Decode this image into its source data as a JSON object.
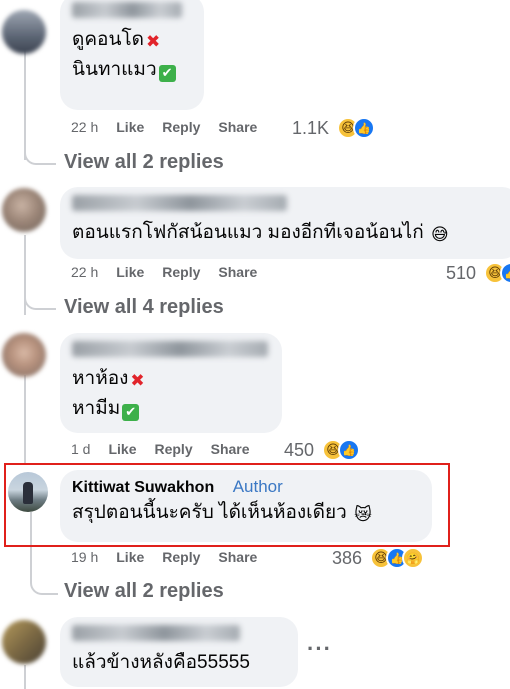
{
  "comments": [
    {
      "lines": [
        "ดูคอนโด",
        "นินทาแมว"
      ],
      "line_marks": [
        "x",
        "check"
      ],
      "meta": {
        "time": "22 h",
        "like": "Like",
        "reply": "Reply",
        "share": "Share"
      },
      "reaction_count": "1.1K",
      "view_replies": "View all 2 replies"
    },
    {
      "lines": [
        "ตอนแรกโฟกัสน้อนแมว มองอีกทีเจอน้อนไก่"
      ],
      "line_emoji": "😅",
      "meta": {
        "time": "22 h",
        "like": "Like",
        "reply": "Reply",
        "share": "Share"
      },
      "reaction_count": "510",
      "view_replies": "View all 4 replies"
    },
    {
      "lines": [
        "หาห้อง",
        "หามีม"
      ],
      "line_marks": [
        "x",
        "check"
      ],
      "meta": {
        "time": "1 d",
        "like": "Like",
        "reply": "Reply",
        "share": "Share"
      },
      "reaction_count": "450"
    },
    {
      "author": "Kittiwat Suwakhon",
      "badge": "Author",
      "lines": [
        "สรุปตอนนี้นะครับ ได้เห็นห้องเดียว"
      ],
      "line_emoji": "😿",
      "meta": {
        "time": "19 h",
        "like": "Like",
        "reply": "Reply",
        "share": "Share"
      },
      "reaction_count": "386",
      "view_replies": "View all 2 replies"
    },
    {
      "lines": [
        "แล้วข้างหลังคือ55555"
      ],
      "more": "···"
    }
  ],
  "icons": {
    "x_mark": "✖",
    "check_mark": "✔",
    "haha": "😆",
    "like": "👍",
    "care": "🤗"
  },
  "colors": {
    "bubble": "#f0f2f5",
    "meta_text": "#65676b",
    "author_badge": "#3b78c4",
    "highlight_border": "#e0201b"
  }
}
